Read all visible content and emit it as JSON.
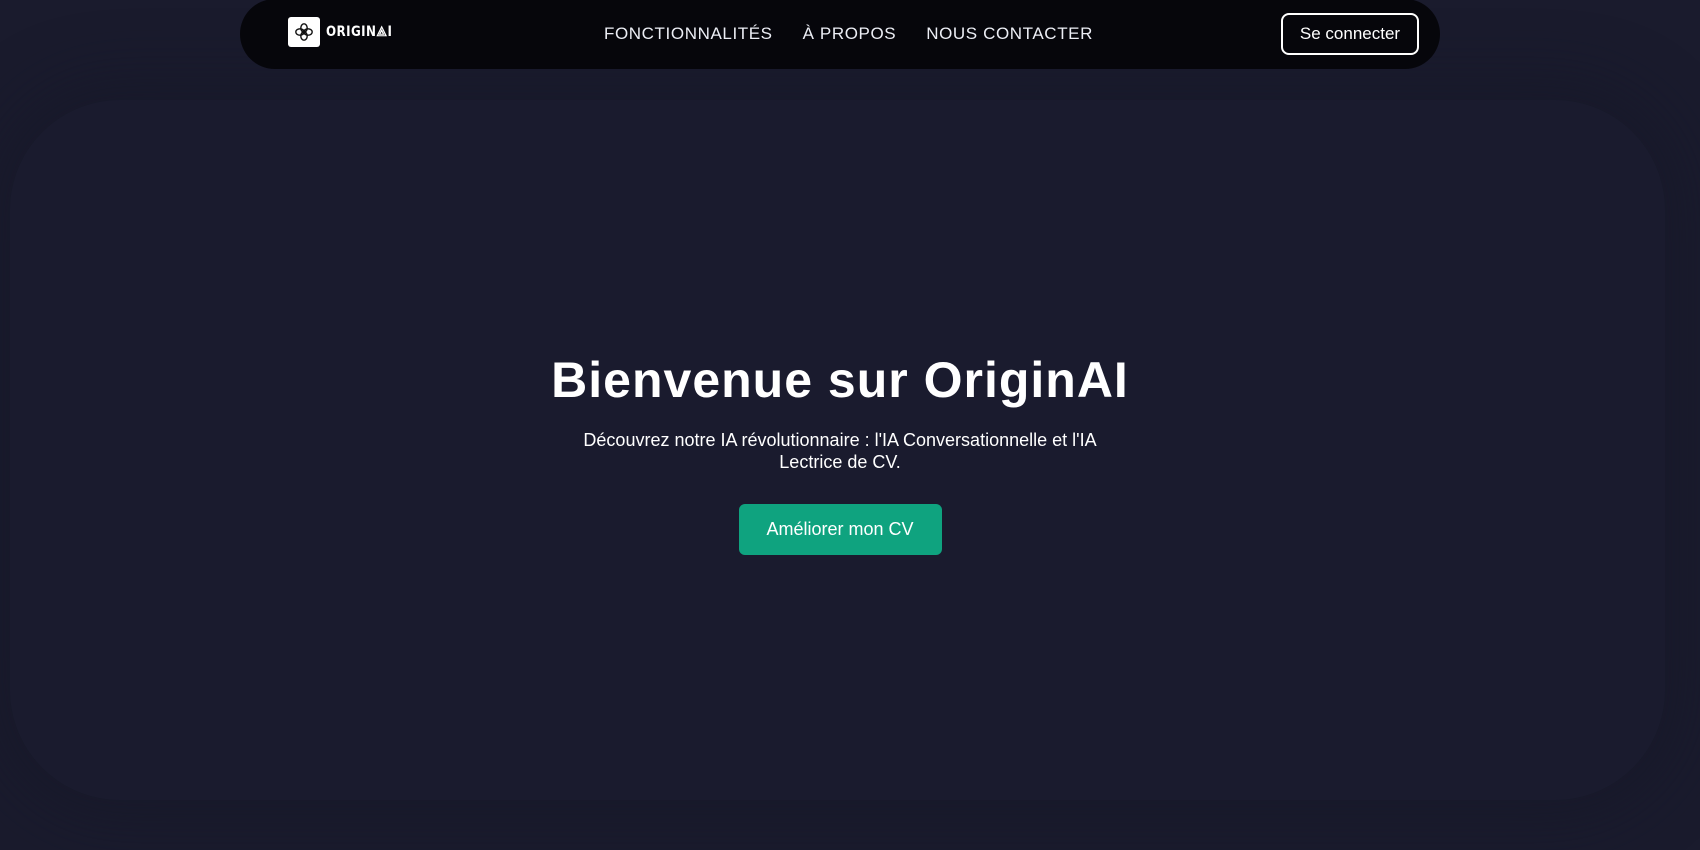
{
  "nav": {
    "brand_name": "ORIGIN⟁I",
    "links": [
      "FONCTIONNALITÉS",
      "À PROPOS",
      "NOUS CONTACTER"
    ],
    "login_label": "Se connecter"
  },
  "hero": {
    "title": "Bienvenue sur OriginAI",
    "subtitle": "Découvrez notre IA révolutionnaire : l'IA Conversationnelle et l'IA Lectrice de CV.",
    "cta_label": "Améliorer mon CV"
  },
  "colors": {
    "background": "#1a1b2d",
    "navbar": "#06060b",
    "accent": "#0fa37f",
    "text": "#ffffff"
  },
  "icons": {
    "brand_logo": "flower-knot-icon"
  }
}
